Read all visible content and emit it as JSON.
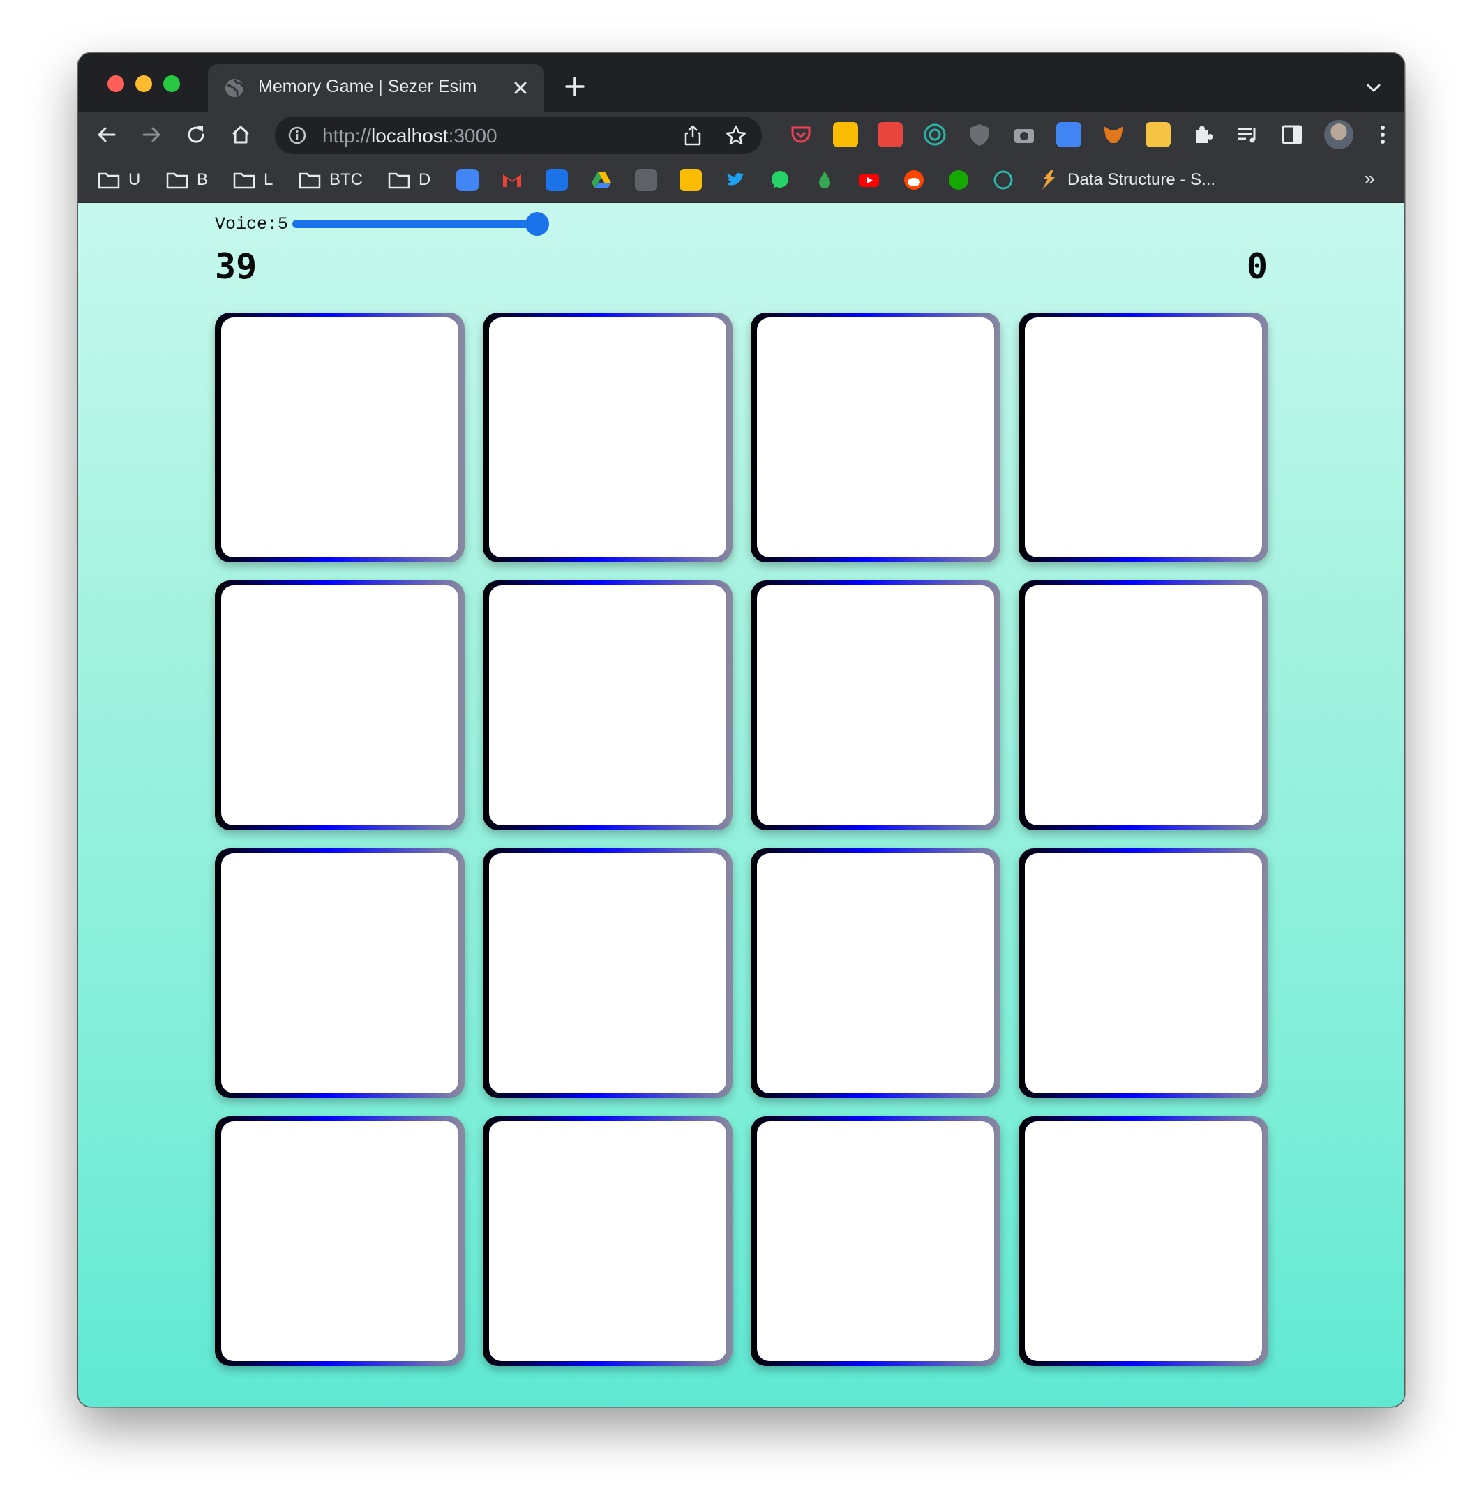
{
  "browser": {
    "tab_title": "Memory Game | Sezer Esim",
    "url_scheme": "http://",
    "url_host": "localhost",
    "url_port": ":3000",
    "bookmarks": [
      {
        "label": "U",
        "type": "folder"
      },
      {
        "label": "B",
        "type": "folder"
      },
      {
        "label": "L",
        "type": "folder"
      },
      {
        "label": "BTC",
        "type": "folder"
      },
      {
        "label": "D",
        "type": "folder"
      }
    ],
    "bookmark_site_label": "Data Structure - S...",
    "more_bookmarks": "»",
    "extension_icons": [
      "pocket-icon",
      "keep-icon",
      "flower-icon",
      "target-icon",
      "ublock-icon",
      "camera-icon",
      "translate-icon",
      "metamask-icon",
      "notes-icon",
      "puzzle-icon",
      "playlist-icon",
      "sidepanel-icon",
      "profile-avatar",
      "kebab-icon"
    ],
    "bookmark_icons": [
      "translate",
      "gmail",
      "calendar",
      "drive",
      "chart",
      "keep",
      "twitter",
      "whatsapp",
      "drop",
      "youtube",
      "reddit",
      "upwork",
      "clock"
    ]
  },
  "game": {
    "voice_label": "Voice:5",
    "voice_value": 5,
    "score_left": "39",
    "score_right": "0",
    "card_count": 16,
    "columns": 4
  },
  "colors": {
    "page_top": "#c7f8ee",
    "page_bottom": "#5fe8d3",
    "slider": "#1a73e8",
    "card_border_start": "#000000",
    "card_border_mid": "#0000ff",
    "card_border_end": "#8a8a9e"
  }
}
